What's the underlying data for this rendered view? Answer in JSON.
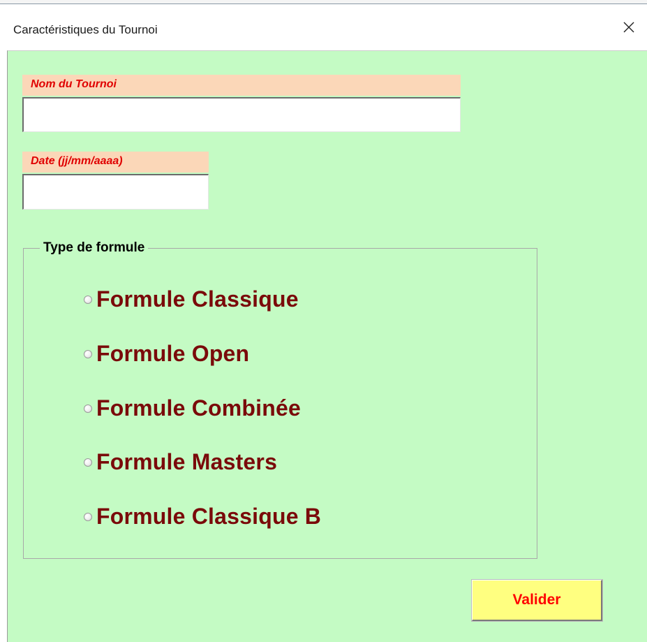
{
  "window": {
    "title": "Caractéristiques du Tournoi",
    "close_icon": "close-icon"
  },
  "form": {
    "name_label": "Nom du Tournoi",
    "name_value": "",
    "date_label": "Date (jj/mm/aaaa)",
    "date_value": ""
  },
  "formula_group": {
    "legend": "Type de formule",
    "options": [
      {
        "label": "Formule Classique",
        "selected": false
      },
      {
        "label": "Formule Open",
        "selected": false
      },
      {
        "label": "Formule Combinée",
        "selected": false
      },
      {
        "label": "Formule Masters",
        "selected": false
      },
      {
        "label": "Formule Classique B",
        "selected": false
      }
    ]
  },
  "actions": {
    "submit_label": "Valider"
  },
  "colors": {
    "client_background": "#c4fbc4",
    "label_background": "#fbd7b8",
    "label_text": "#e00000",
    "option_text": "#7a0a0a",
    "button_background": "#ffff80",
    "button_text": "#ff0000"
  }
}
